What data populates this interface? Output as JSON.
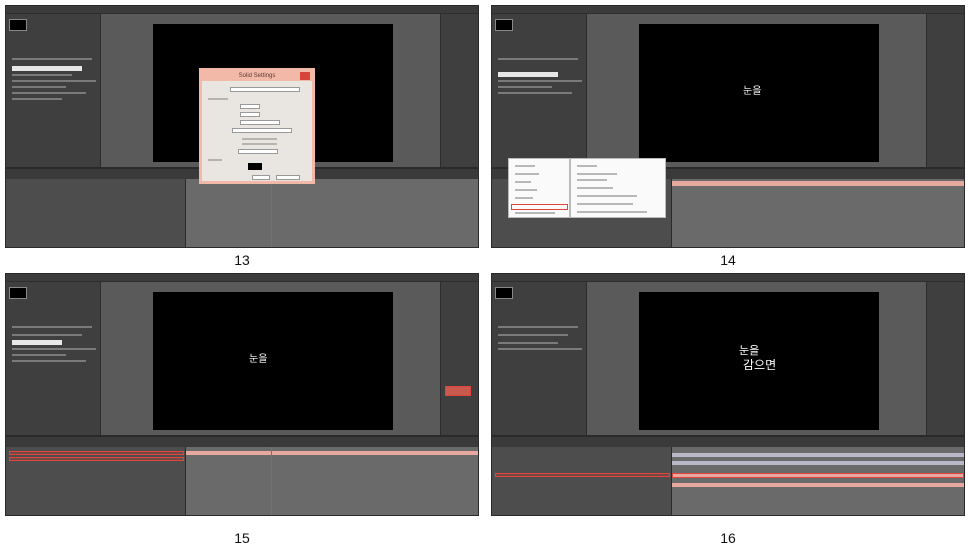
{
  "panels": [
    {
      "caption": "13",
      "app": "After Effects",
      "dialog": {
        "title": "Solid Settings"
      }
    },
    {
      "caption": "14",
      "app": "After Effects",
      "comp_text": "눈을"
    },
    {
      "caption": "15",
      "app": "After Effects",
      "comp_text": "눈을"
    },
    {
      "caption": "16",
      "app": "After Effects",
      "comp_text_top": "눈을",
      "comp_text_bottom": "감으면"
    }
  ],
  "colors": {
    "highlight": "#e0443a",
    "dialog_border": "#f2b9a8",
    "app_bg": "#4a4a4a"
  }
}
